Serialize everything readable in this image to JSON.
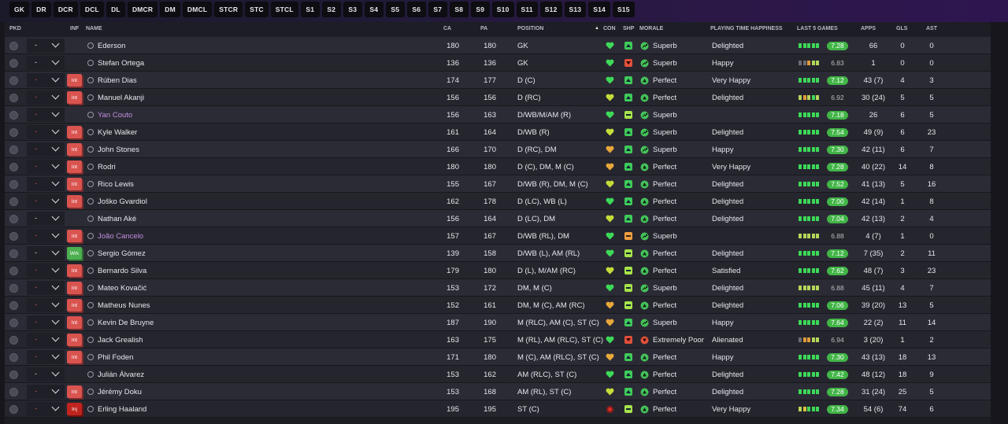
{
  "tabs": [
    "GK",
    "DR",
    "DCR",
    "DCL",
    "DL",
    "DMCR",
    "DM",
    "DMCL",
    "STCR",
    "STC",
    "STCL",
    "S1",
    "S2",
    "S3",
    "S4",
    "S5",
    "S6",
    "S7",
    "S8",
    "S9",
    "S10",
    "S11",
    "S12",
    "S13",
    "S14",
    "S15"
  ],
  "headers": {
    "pkd": "PKD",
    "inf": "INF",
    "name": "NAME",
    "ca": "CA",
    "pa": "PA",
    "position": "POSITION",
    "con": "CON",
    "shp": "SHP",
    "morale": "MORALE",
    "happiness": "PLAYING TIME HAPPINESS",
    "last5": "LAST 5 GAMES",
    "apps": "APPS",
    "gls": "GLS",
    "ast": "AST"
  },
  "colors": {
    "int_badge": "#d9534f",
    "wrk_badge": "#4caf50",
    "inj_badge": "#c0241f",
    "loan_name": "#c28fe0",
    "rating_good": "#42b547"
  },
  "players": [
    {
      "name": "Ederson",
      "inf": "",
      "ca": "180",
      "pa": "180",
      "pos": "GK",
      "con": "g",
      "shp": "up",
      "morale": "Superb",
      "mor_icon": "thumb",
      "happy": "Delighted",
      "form": [
        "g",
        "g",
        "g",
        "g",
        "g"
      ],
      "rating": "7.28",
      "rclass": "good",
      "apps": "66",
      "gls": "0",
      "ast": "0",
      "dash": "-",
      "dash_red": false,
      "loan": false
    },
    {
      "name": "Stefan Ortega",
      "inf": "",
      "ca": "136",
      "pa": "136",
      "pos": "GK",
      "con": "g",
      "shp": "down",
      "morale": "Superb",
      "mor_icon": "thumb",
      "happy": "Happy",
      "form": [
        "gr",
        "gr",
        "o",
        "lg",
        "lg"
      ],
      "rating": "6.83",
      "rclass": "mid",
      "apps": "1",
      "gls": "0",
      "ast": "0",
      "dash": "-",
      "dash_red": false,
      "loan": false
    },
    {
      "name": "Rúben Dias",
      "inf": "Int",
      "ca": "174",
      "pa": "177",
      "pos": "D (C)",
      "con": "g",
      "shp": "up",
      "morale": "Perfect",
      "mor_icon": "up",
      "happy": "Very Happy",
      "form": [
        "g",
        "g",
        "g",
        "g",
        "g"
      ],
      "rating": "7.12",
      "rclass": "good",
      "apps": "43 (7)",
      "gls": "4",
      "ast": "3",
      "dash": "-",
      "dash_red": true,
      "loan": false
    },
    {
      "name": "Manuel Akanji",
      "inf": "Int",
      "ca": "156",
      "pa": "156",
      "pos": "D (RC)",
      "con": "y",
      "shp": "up",
      "morale": "Perfect",
      "mor_icon": "up",
      "happy": "Delighted",
      "form": [
        "lg",
        "o",
        "lg",
        "g",
        "lg"
      ],
      "rating": "6.92",
      "rclass": "mid",
      "apps": "30 (24)",
      "gls": "5",
      "ast": "5",
      "dash": "-",
      "dash_red": true,
      "loan": false
    },
    {
      "name": "Yan Couto",
      "inf": "",
      "ca": "156",
      "pa": "163",
      "pos": "D/WB/M/AM (R)",
      "con": "g",
      "shp": "flat",
      "morale": "Superb",
      "mor_icon": "thumb",
      "happy": "",
      "form": [
        "g",
        "g",
        "g",
        "g",
        "g"
      ],
      "rating": "7.18",
      "rclass": "good",
      "apps": "26",
      "gls": "6",
      "ast": "5",
      "dash": "-",
      "dash_red": true,
      "loan": true
    },
    {
      "name": "Kyle Walker",
      "inf": "Int",
      "ca": "161",
      "pa": "164",
      "pos": "D/WB (R)",
      "con": "y",
      "shp": "up",
      "morale": "Superb",
      "mor_icon": "thumb",
      "happy": "Delighted",
      "form": [
        "g",
        "g",
        "g",
        "g",
        "g"
      ],
      "rating": "7.54",
      "rclass": "good",
      "apps": "49 (9)",
      "gls": "6",
      "ast": "23",
      "dash": "-",
      "dash_red": true,
      "loan": false
    },
    {
      "name": "John Stones",
      "inf": "Int",
      "ca": "166",
      "pa": "170",
      "pos": "D (RC), DM",
      "con": "o",
      "shp": "up",
      "morale": "Superb",
      "mor_icon": "thumb",
      "happy": "Happy",
      "form": [
        "g",
        "g",
        "g",
        "g",
        "g"
      ],
      "rating": "7.30",
      "rclass": "good",
      "apps": "42 (11)",
      "gls": "6",
      "ast": "7",
      "dash": "-",
      "dash_red": true,
      "loan": false
    },
    {
      "name": "Rodri",
      "inf": "Int",
      "ca": "180",
      "pa": "180",
      "pos": "D (C), DM, M (C)",
      "con": "o",
      "shp": "up",
      "morale": "Perfect",
      "mor_icon": "up",
      "happy": "Very Happy",
      "form": [
        "g",
        "g",
        "g",
        "g",
        "g"
      ],
      "rating": "7.28",
      "rclass": "good",
      "apps": "40 (22)",
      "gls": "14",
      "ast": "8",
      "dash": "-",
      "dash_red": true,
      "loan": false
    },
    {
      "name": "Rico Lewis",
      "inf": "Int",
      "ca": "155",
      "pa": "167",
      "pos": "D/WB (R), DM, M (C)",
      "con": "y",
      "shp": "up",
      "morale": "Perfect",
      "mor_icon": "up",
      "happy": "Delighted",
      "form": [
        "g",
        "g",
        "g",
        "g",
        "g"
      ],
      "rating": "7.52",
      "rclass": "good",
      "apps": "41 (13)",
      "gls": "5",
      "ast": "16",
      "dash": "-",
      "dash_red": true,
      "loan": false
    },
    {
      "name": "Joško Gvardiol",
      "inf": "Int",
      "ca": "162",
      "pa": "178",
      "pos": "D (LC), WB (L)",
      "con": "g",
      "shp": "up",
      "morale": "Perfect",
      "mor_icon": "up",
      "happy": "Delighted",
      "form": [
        "g",
        "g",
        "g",
        "g",
        "g"
      ],
      "rating": "7.00",
      "rclass": "good",
      "apps": "42 (14)",
      "gls": "1",
      "ast": "8",
      "dash": "-",
      "dash_red": true,
      "loan": false
    },
    {
      "name": "Nathan Aké",
      "inf": "",
      "ca": "156",
      "pa": "164",
      "pos": "D (LC), DM",
      "con": "y",
      "shp": "up",
      "morale": "Perfect",
      "mor_icon": "up",
      "happy": "Delighted",
      "form": [
        "g",
        "g",
        "g",
        "g",
        "g"
      ],
      "rating": "7.04",
      "rclass": "good",
      "apps": "42 (13)",
      "gls": "2",
      "ast": "4",
      "dash": "-",
      "dash_red": false,
      "loan": false
    },
    {
      "name": "João Cancelo",
      "inf": "Int",
      "ca": "157",
      "pa": "167",
      "pos": "D/WB (RL), DM",
      "con": "g",
      "shp": "orange",
      "morale": "Superb",
      "mor_icon": "thumb",
      "happy": "",
      "form": [
        "lg",
        "lg",
        "lg",
        "lg",
        "lg"
      ],
      "rating": "6.88",
      "rclass": "mid",
      "apps": "4 (7)",
      "gls": "1",
      "ast": "0",
      "dash": "-",
      "dash_red": true,
      "loan": true
    },
    {
      "name": "Sergio Gómez",
      "inf": "Wrk",
      "ca": "139",
      "pa": "158",
      "pos": "D/WB (L), AM (RL)",
      "con": "g",
      "shp": "flat",
      "morale": "Perfect",
      "mor_icon": "up",
      "happy": "Delighted",
      "form": [
        "g",
        "g",
        "g",
        "g",
        "g"
      ],
      "rating": "7.12",
      "rclass": "good",
      "apps": "7 (35)",
      "gls": "2",
      "ast": "11",
      "dash": "-",
      "dash_red": false,
      "loan": false
    },
    {
      "name": "Bernardo Silva",
      "inf": "Int",
      "ca": "179",
      "pa": "180",
      "pos": "D (L), M/AM (RC)",
      "con": "y",
      "shp": "flat",
      "morale": "Perfect",
      "mor_icon": "up",
      "happy": "Satisfied",
      "form": [
        "g",
        "g",
        "g",
        "g",
        "g"
      ],
      "rating": "7.62",
      "rclass": "good",
      "apps": "48 (7)",
      "gls": "3",
      "ast": "23",
      "dash": "-",
      "dash_red": true,
      "loan": false
    },
    {
      "name": "Mateo Kovačić",
      "inf": "Int",
      "ca": "153",
      "pa": "172",
      "pos": "DM, M (C)",
      "con": "g",
      "shp": "flat",
      "morale": "Superb",
      "mor_icon": "thumb",
      "happy": "Delighted",
      "form": [
        "lg",
        "lg",
        "lg",
        "lg",
        "lg"
      ],
      "rating": "6.88",
      "rclass": "mid",
      "apps": "45 (11)",
      "gls": "4",
      "ast": "7",
      "dash": "-",
      "dash_red": true,
      "loan": false
    },
    {
      "name": "Matheus Nunes",
      "inf": "Int",
      "ca": "152",
      "pa": "161",
      "pos": "DM, M (C), AM (RC)",
      "con": "o",
      "shp": "flat",
      "morale": "Perfect",
      "mor_icon": "up",
      "happy": "Delighted",
      "form": [
        "g",
        "g",
        "g",
        "g",
        "g"
      ],
      "rating": "7.06",
      "rclass": "good",
      "apps": "39 (20)",
      "gls": "13",
      "ast": "5",
      "dash": "-",
      "dash_red": true,
      "loan": false
    },
    {
      "name": "Kevin De Bruyne",
      "inf": "Int",
      "ca": "187",
      "pa": "190",
      "pos": "M (RLC), AM (C), ST (C)",
      "con": "o",
      "shp": "up",
      "morale": "Superb",
      "mor_icon": "thumb",
      "happy": "Happy",
      "form": [
        "g",
        "g",
        "g",
        "g",
        "g"
      ],
      "rating": "7.64",
      "rclass": "good",
      "apps": "22 (2)",
      "gls": "11",
      "ast": "14",
      "dash": "-",
      "dash_red": true,
      "loan": false
    },
    {
      "name": "Jack Grealish",
      "inf": "Int",
      "ca": "163",
      "pa": "175",
      "pos": "M (RL), AM (RLC), ST (C)",
      "con": "g",
      "shp": "down",
      "morale": "Extremely Poor",
      "mor_icon": "down",
      "happy": "Alienated",
      "form": [
        "gr",
        "o",
        "o",
        "lg",
        "lg"
      ],
      "rating": "6.94",
      "rclass": "mid",
      "apps": "3 (20)",
      "gls": "1",
      "ast": "2",
      "dash": "-",
      "dash_red": true,
      "loan": false
    },
    {
      "name": "Phil Foden",
      "inf": "Int",
      "ca": "171",
      "pa": "180",
      "pos": "M (C), AM (RLC), ST (C)",
      "con": "o",
      "shp": "up",
      "morale": "Perfect",
      "mor_icon": "up",
      "happy": "Happy",
      "form": [
        "g",
        "g",
        "g",
        "g",
        "g"
      ],
      "rating": "7.30",
      "rclass": "good",
      "apps": "43 (13)",
      "gls": "18",
      "ast": "13",
      "dash": "-",
      "dash_red": true,
      "loan": false
    },
    {
      "name": "Julián Álvarez",
      "inf": "",
      "ca": "153",
      "pa": "162",
      "pos": "AM (RLC), ST (C)",
      "con": "g",
      "shp": "up",
      "morale": "Perfect",
      "mor_icon": "up",
      "happy": "Delighted",
      "form": [
        "g",
        "g",
        "g",
        "g",
        "g"
      ],
      "rating": "7.42",
      "rclass": "good",
      "apps": "48 (12)",
      "gls": "18",
      "ast": "9",
      "dash": "-",
      "dash_red": false,
      "loan": false
    },
    {
      "name": "Jérémy Doku",
      "inf": "Int",
      "ca": "153",
      "pa": "168",
      "pos": "AM (RL), ST (C)",
      "con": "y",
      "shp": "up",
      "morale": "Perfect",
      "mor_icon": "up",
      "happy": "Delighted",
      "form": [
        "g",
        "g",
        "g",
        "g",
        "g"
      ],
      "rating": "7.28",
      "rclass": "good",
      "apps": "31 (24)",
      "gls": "25",
      "ast": "5",
      "dash": "-",
      "dash_red": true,
      "loan": false
    },
    {
      "name": "Erling Haaland",
      "inf": "Inj",
      "ca": "195",
      "pa": "195",
      "pos": "ST (C)",
      "con": "r",
      "shp": "flat",
      "morale": "Perfect",
      "mor_icon": "up",
      "happy": "Very Happy",
      "form": [
        "lg",
        "y",
        "g",
        "g",
        "g"
      ],
      "rating": "7.34",
      "rclass": "good",
      "apps": "54 (6)",
      "gls": "74",
      "ast": "6",
      "dash": "-",
      "dash_red": true,
      "loan": false
    }
  ]
}
